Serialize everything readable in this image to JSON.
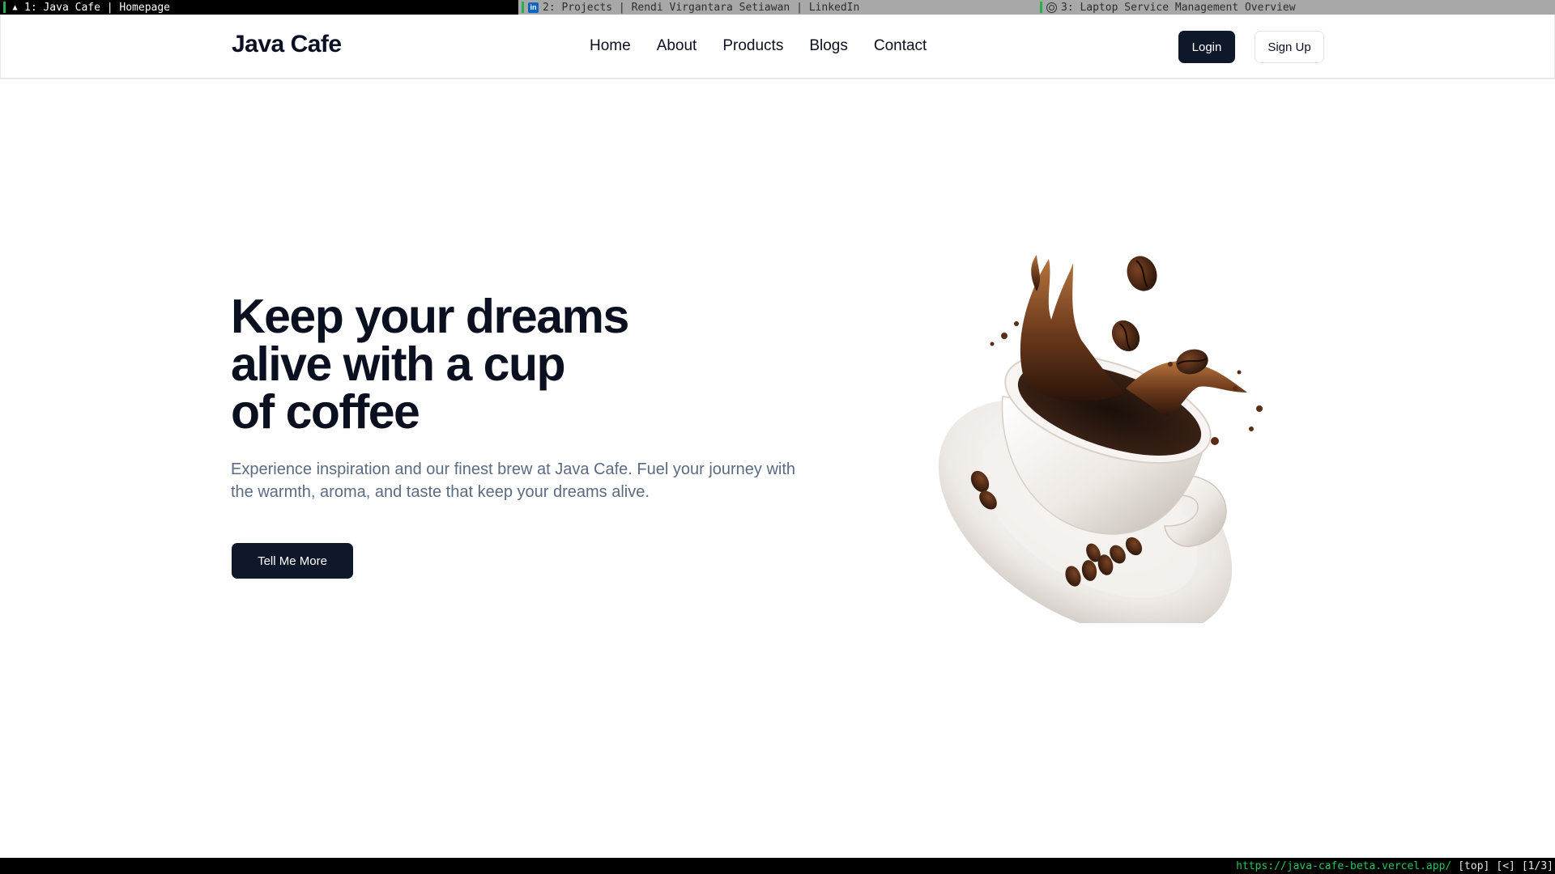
{
  "browser": {
    "tabs": [
      {
        "label": "1: Java Cafe | Homepage",
        "icon": "arrow-icon",
        "active": true
      },
      {
        "label": "2: Projects | Rendi Virgantara Setiawan | LinkedIn",
        "icon": "linkedin-icon",
        "active": false
      },
      {
        "label": "3: Laptop Service Management Overview",
        "icon": "chatgpt-icon",
        "active": false
      }
    ],
    "status": {
      "url": "https://java-cafe-beta.vercel.app/",
      "scroll": "[top]",
      "history": "[<]",
      "tab_index": "[1/3]"
    }
  },
  "header": {
    "logo": "Java Cafe",
    "nav": [
      "Home",
      "About",
      "Products",
      "Blogs",
      "Contact"
    ],
    "login_label": "Login",
    "signup_label": "Sign Up"
  },
  "hero": {
    "title_lines": [
      "Keep your dreams",
      "alive with a cup",
      "of coffee"
    ],
    "subtitle": "Experience inspiration and our finest brew at Java Cafe. Fuel your journey with the warmth, aroma, and taste that keep your dreams alive.",
    "cta_label": "Tell Me More",
    "image": "coffee-cup-splash"
  },
  "colors": {
    "primary": "#0f172a",
    "text": "#0b1020",
    "muted": "#5b6b82",
    "status_url": "#22c55e"
  }
}
